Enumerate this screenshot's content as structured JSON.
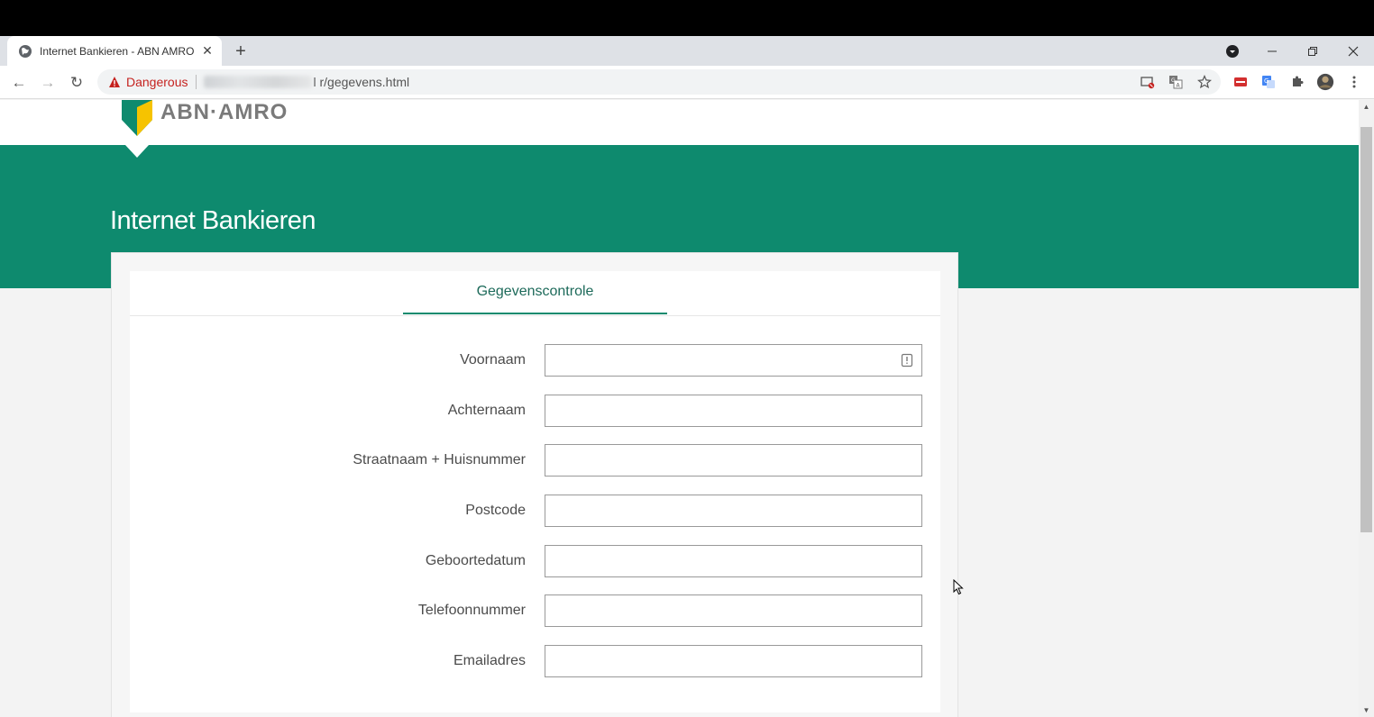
{
  "browser": {
    "tab_title": "Internet Bankieren - ABN AMRO",
    "tab_close": "✕",
    "new_tab": "+",
    "security_label": "Dangerous",
    "url_visible": "l      r/gegevens.html",
    "back": "←",
    "forward": "→",
    "reload": "↻"
  },
  "site": {
    "logo_text": "ABN·AMRO",
    "banner_title": "Internet Bankieren",
    "tab_label": "Gegevenscontrole",
    "colors": {
      "brand_green": "#0e8a6e",
      "logo_yellow": "#f6c300",
      "danger_red": "#c5221f"
    }
  },
  "form": {
    "fields": [
      {
        "label": "Voornaam",
        "value": ""
      },
      {
        "label": "Achternaam",
        "value": ""
      },
      {
        "label": "Straatnaam + Huisnummer",
        "value": ""
      },
      {
        "label": "Postcode",
        "value": ""
      },
      {
        "label": "Geboortedatum",
        "value": ""
      },
      {
        "label": "Telefoonnummer",
        "value": ""
      },
      {
        "label": "Emailadres",
        "value": ""
      }
    ]
  }
}
